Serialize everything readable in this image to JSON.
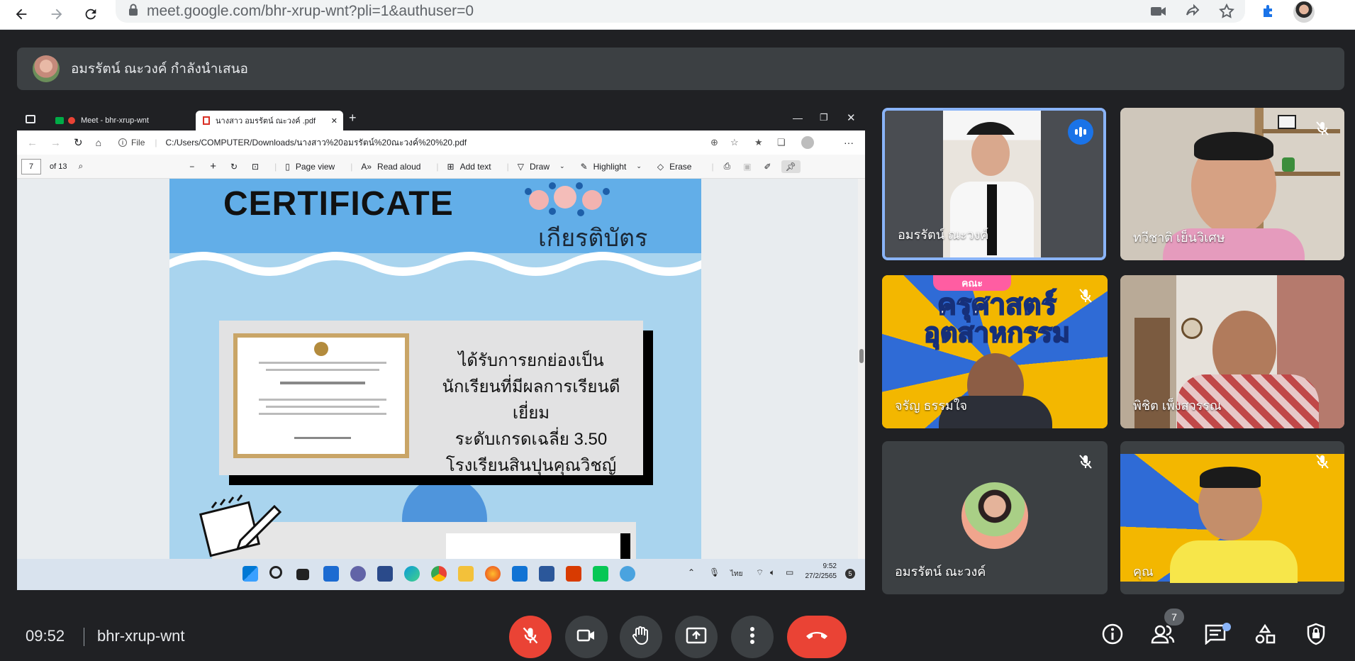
{
  "browser": {
    "url": "meet.google.com/bhr-xrup-wnt?pli=1&authuser=0"
  },
  "presenter_banner": {
    "text": "อมรรัตน์ ณะวงค์ กำลังนำเสนอ"
  },
  "shared_screen": {
    "edge": {
      "tabs": [
        {
          "label": "Meet - bhr-xrup-wnt"
        },
        {
          "label": "นางสาว อมรรัตน์ ณะวงค์ .pdf"
        }
      ],
      "file_label": "File",
      "address": "C:/Users/COMPUTER/Downloads/นางสาว%20อมรรัตน์%20ณะวงค์%20%20.pdf"
    },
    "pdf_toolbar": {
      "page_current": "7",
      "page_total": "of 13",
      "page_view": "Page view",
      "read_aloud": "Read aloud",
      "add_text": "Add text",
      "draw": "Draw",
      "highlight": "Highlight",
      "erase": "Erase"
    },
    "certificate": {
      "title": "CERTIFICATE",
      "thai_title": "เกียรติบัตร",
      "lines": [
        "ได้รับการยกย่องเป็น",
        "นักเรียนที่มีผลการเรียนดีเยี่ยม",
        "ระดับเกรดเฉลี่ย 3.50",
        "โรงเรียนสินปุนคุณวิชญ์"
      ]
    },
    "taskbar": {
      "language": "ไทย",
      "time": "9:52",
      "date": "27/2/2565",
      "notifications": "5"
    }
  },
  "participants": [
    {
      "name": "อมรรัตน์ ณะวงค์",
      "speaking": true
    },
    {
      "name": "ทวีชาติ เย็นวิเศษ",
      "muted": true
    },
    {
      "name": "จรัญ ธรรมใจ",
      "muted": true
    },
    {
      "name": "พิชิต เพ็งสวรรณ",
      "muted": false
    },
    {
      "name": "อมรรัตน์ ณะวงค์",
      "muted": true
    },
    {
      "name": "คุณ",
      "muted": true
    }
  ],
  "tile_texts": {
    "tile3_sign_line1": "คณะ",
    "tile3_sign_line2": "ครุศาสตร์",
    "tile3_sign_line3": "อุตสาหกรรม"
  },
  "bottom_bar": {
    "time": "09:52",
    "meeting_code": "bhr-xrup-wnt",
    "people_count": "7"
  },
  "colors": {
    "meet_bg": "#202124",
    "tile_bg": "#3c4043",
    "danger": "#ea4335",
    "active_border": "#8ab4f8"
  }
}
